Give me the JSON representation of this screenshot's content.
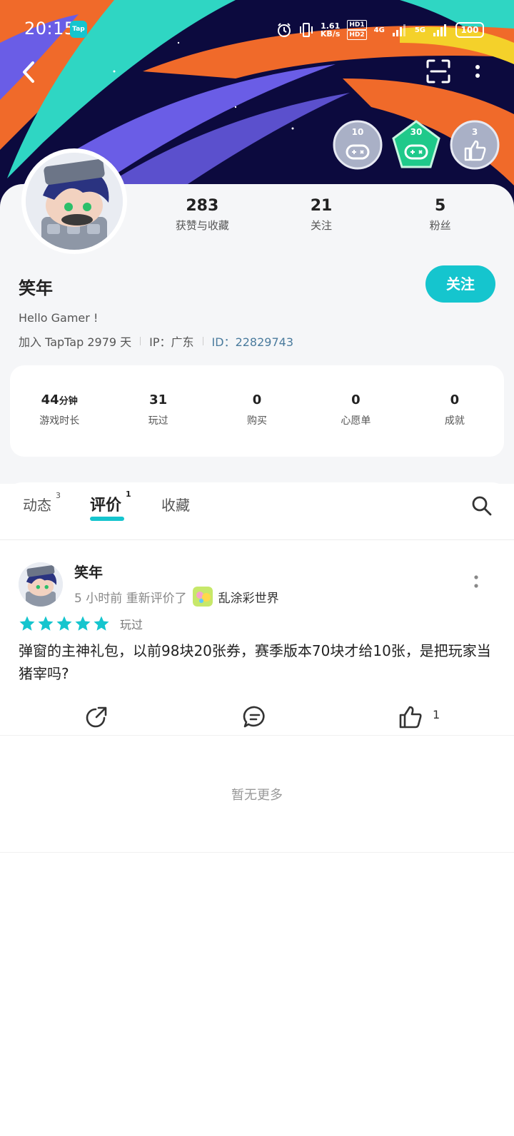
{
  "status_bar": {
    "time": "20:15",
    "app_badge": "Tap",
    "net_speed_value": "1.61",
    "net_speed_unit": "KB/s",
    "hd1": "HD1",
    "hd2": "HD2",
    "sig1": "4G",
    "sig2": "5G",
    "battery": "100"
  },
  "badges": [
    {
      "number": "10",
      "icon": "gamepad-icon",
      "color": "#a9b0c6"
    },
    {
      "number": "30",
      "icon": "gamepad-icon",
      "color": "#1fc98a"
    },
    {
      "number": "3",
      "icon": "thumbs-up-icon",
      "color": "#a9b0c6"
    }
  ],
  "profile": {
    "stats_top": [
      {
        "value": "283",
        "label": "获赞与收藏"
      },
      {
        "value": "21",
        "label": "关注"
      },
      {
        "value": "5",
        "label": "粉丝"
      }
    ],
    "username": "笑年",
    "follow_label": "关注",
    "bio": "Hello Gamer !",
    "joined": "加入 TapTap 2979 天",
    "ip": "IP：广东",
    "id": "ID：22829743"
  },
  "stats": {
    "play_time_value": "44",
    "play_time_unit": "分钟",
    "play_time_label": "游戏时长",
    "played_value": "31",
    "played_label": "玩过",
    "bought_value": "0",
    "bought_label": "购买",
    "wishlist_value": "0",
    "wishlist_label": "心愿单",
    "achievements_value": "0",
    "achievements_label": "成就"
  },
  "tabs": [
    {
      "label": "动态",
      "count": "3"
    },
    {
      "label": "评价",
      "count": "1"
    },
    {
      "label": "收藏",
      "count": ""
    }
  ],
  "post": {
    "author": "笑年",
    "time_action": "5 小时前 重新评价了",
    "game": "乱涂彩世界",
    "rating": 5,
    "played_label": "玩过",
    "body": "弹窗的主神礼包，以前98块20张券，赛季版本70块才给10张，是把玩家当猪宰吗?",
    "like_count": "1"
  },
  "footer": {
    "no_more": "暂无更多"
  },
  "colors": {
    "accent": "#15c5ce",
    "id_link": "#4a7b9d"
  }
}
